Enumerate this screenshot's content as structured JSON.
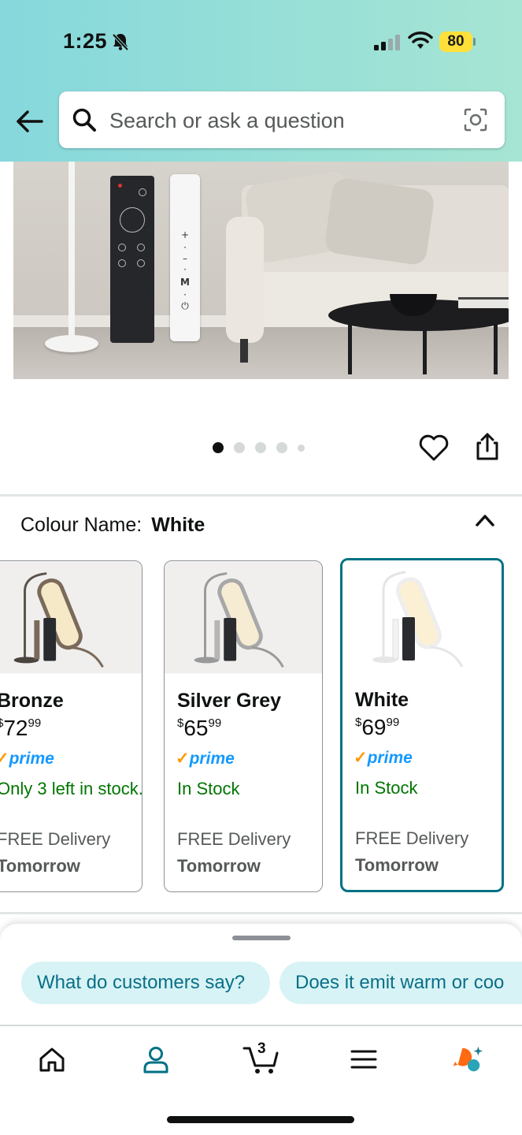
{
  "status_bar": {
    "time": "1:25",
    "battery": "80"
  },
  "header": {
    "search_placeholder": "Search or ask a question"
  },
  "product_images": {
    "total": 5,
    "current": 1
  },
  "lamp_bar_labels": [
    "+",
    "·",
    "–",
    "·",
    "M",
    "·",
    "⏻"
  ],
  "colour": {
    "label": "Colour Name:",
    "selected": "White"
  },
  "variants": [
    {
      "name": "Bronze",
      "currency": "$",
      "price_whole": "72",
      "price_fraction": "99",
      "prime": "prime",
      "stock": "Only 3 left in stock.",
      "delivery": "FREE Delivery",
      "delivery_when": "Tomorrow"
    },
    {
      "name": "Silver Grey",
      "currency": "$",
      "price_whole": "65",
      "price_fraction": "99",
      "prime": "prime",
      "stock": "In Stock",
      "delivery": "FREE Delivery",
      "delivery_when": "Tomorrow"
    },
    {
      "name": "White",
      "currency": "$",
      "price_whole": "69",
      "price_fraction": "99",
      "prime": "prime",
      "stock": "In Stock",
      "delivery": "FREE Delivery",
      "delivery_when": "Tomorrow"
    }
  ],
  "suggestions": [
    "What do customers say?",
    "Does it emit warm or coo"
  ],
  "tab_bar": {
    "cart_count": "3",
    "items": [
      "home-icon",
      "account-icon",
      "cart-icon",
      "menu-icon",
      "rufus-icon"
    ]
  },
  "colors": {
    "accent_teal": "#007185",
    "in_stock_green": "#007600",
    "prime_blue": "#1399ff",
    "prime_check": "#ff9900",
    "chip_bg": "#d7f3f6"
  }
}
